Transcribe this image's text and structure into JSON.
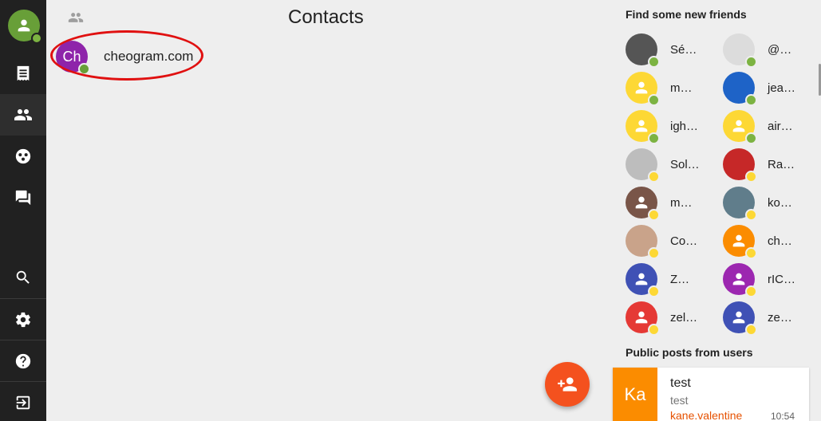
{
  "nav": {
    "items": [
      {
        "name": "notes",
        "icon": "receipt-icon"
      },
      {
        "name": "contacts",
        "icon": "people-icon",
        "active": true
      },
      {
        "name": "groups",
        "icon": "groups-icon"
      },
      {
        "name": "chats",
        "icon": "forum-icon"
      },
      {
        "name": "search",
        "icon": "search-icon"
      },
      {
        "name": "settings",
        "icon": "gear-icon"
      },
      {
        "name": "help",
        "icon": "help-icon"
      },
      {
        "name": "logout",
        "icon": "logout-icon"
      }
    ]
  },
  "main": {
    "title": "Contacts",
    "contacts": [
      {
        "initials": "Ch",
        "name": "cheogram.com",
        "status": "online"
      }
    ]
  },
  "suggestions": {
    "title": "Find some new friends",
    "friends": [
      {
        "name": "Sé…",
        "avatar": "photo",
        "color": "#555555",
        "status": "#7cb342"
      },
      {
        "name": "@…",
        "avatar": "photo",
        "color": "#dcdcdc",
        "status": "#7cb342"
      },
      {
        "name": "m…",
        "avatar": "person",
        "color": "#fdd835",
        "status": "#7cb342"
      },
      {
        "name": "jea…",
        "avatar": "photo",
        "color": "#1e63c7",
        "status": "#7cb342"
      },
      {
        "name": "igh…",
        "avatar": "person",
        "color": "#fdd835",
        "status": "#7cb342"
      },
      {
        "name": "air…",
        "avatar": "person",
        "color": "#fdd835",
        "status": "#7cb342"
      },
      {
        "name": "Sol…",
        "avatar": "photo",
        "color": "#bdbdbd",
        "status": "#fdd835"
      },
      {
        "name": "Ra…",
        "avatar": "photo",
        "color": "#c62828",
        "status": "#fdd835"
      },
      {
        "name": "m…",
        "avatar": "person",
        "color": "#795548",
        "status": "#fdd835"
      },
      {
        "name": "ko…",
        "avatar": "photo",
        "color": "#607d8b",
        "status": "#fdd835"
      },
      {
        "name": "Co…",
        "avatar": "photo",
        "color": "#c9a38a",
        "status": "#fdd835"
      },
      {
        "name": "ch…",
        "avatar": "person",
        "color": "#fb8c00",
        "status": "#fdd835"
      },
      {
        "name": "Z…",
        "avatar": "person",
        "color": "#3f51b5",
        "status": "#fdd835"
      },
      {
        "name": "rIC…",
        "avatar": "person",
        "color": "#9c27b0",
        "status": "#fdd835"
      },
      {
        "name": "zel…",
        "avatar": "person",
        "color": "#e53935",
        "status": "#fdd835"
      },
      {
        "name": "ze…",
        "avatar": "person",
        "color": "#3f51b5",
        "status": "#fdd835"
      }
    ]
  },
  "posts": {
    "title": "Public posts from users",
    "items": [
      {
        "initials": "Ka",
        "title": "test",
        "body": "test",
        "author": "kane.valentine",
        "time": "10:54"
      }
    ]
  }
}
